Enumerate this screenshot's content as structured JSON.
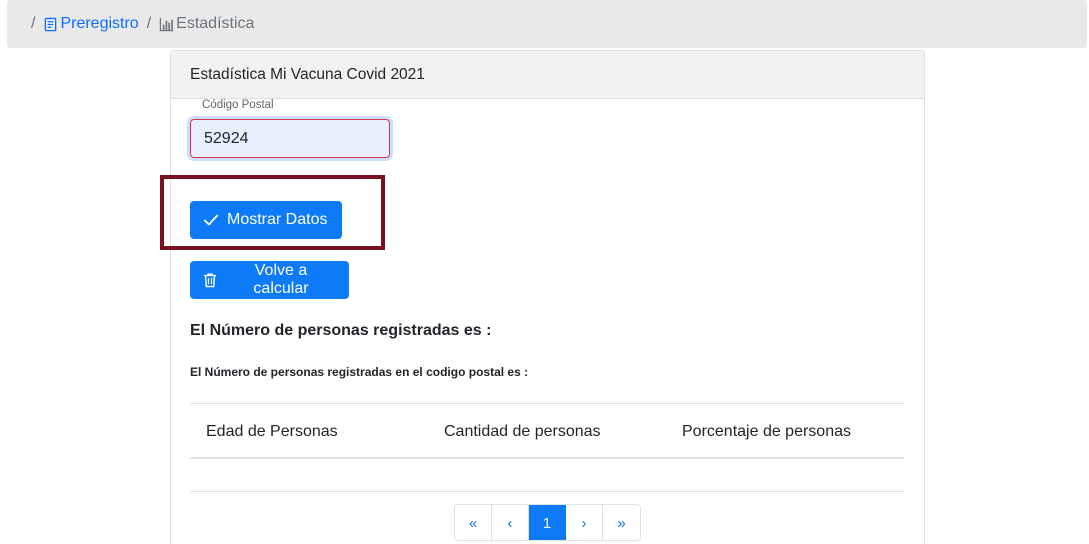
{
  "breadcrumb": {
    "separator": "/",
    "link_label": "Preregistro",
    "current_label": "Estadística"
  },
  "card": {
    "title": "Estadística Mi Vacuna Covid 2021"
  },
  "form": {
    "postal_label": "Código Postal",
    "postal_value": "52924"
  },
  "buttons": {
    "show_label": "Mostrar Datos",
    "recalc_label": "Volve a calcular"
  },
  "results": {
    "total_heading": "El Número de personas registradas es :",
    "postal_heading": "El Número de personas registradas en el codigo postal es :"
  },
  "table": {
    "columns": [
      "Edad de Personas",
      "Cantidad de personas",
      "Porcentaje de personas"
    ]
  },
  "pagination": {
    "first": "«",
    "prev": "‹",
    "current": "1",
    "next": "›",
    "last": "»"
  },
  "colors": {
    "primary": "#0d7bf7",
    "highlight": "#7b1022",
    "input_error_border": "#dc3545"
  }
}
